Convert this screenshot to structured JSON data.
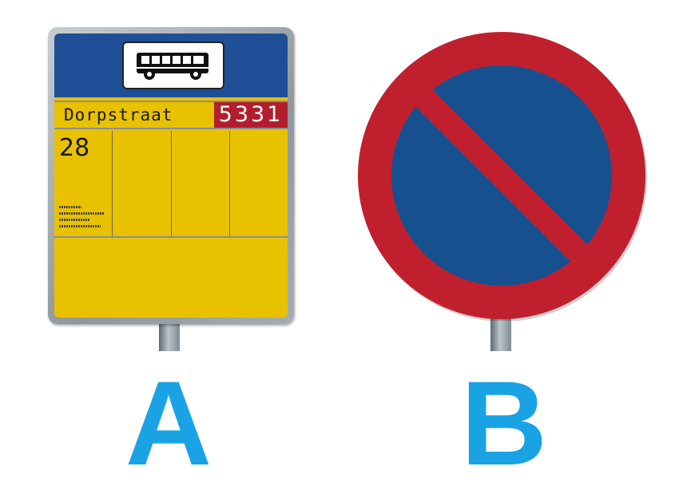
{
  "sign_a": {
    "label": "A",
    "type": "bus stop sign",
    "icon": "bus-icon",
    "stop_name": "Dorpstraat",
    "stop_code": "5331",
    "route_number": "28",
    "colors": {
      "header": "#1f4f96",
      "board": "#e8c100",
      "code_bg": "#b21e2d"
    }
  },
  "sign_b": {
    "label": "B",
    "type": "no parking sign",
    "colors": {
      "ring": "#c0202e",
      "field": "#17508f"
    }
  },
  "colors": {
    "letters": "#1aa3e4"
  }
}
